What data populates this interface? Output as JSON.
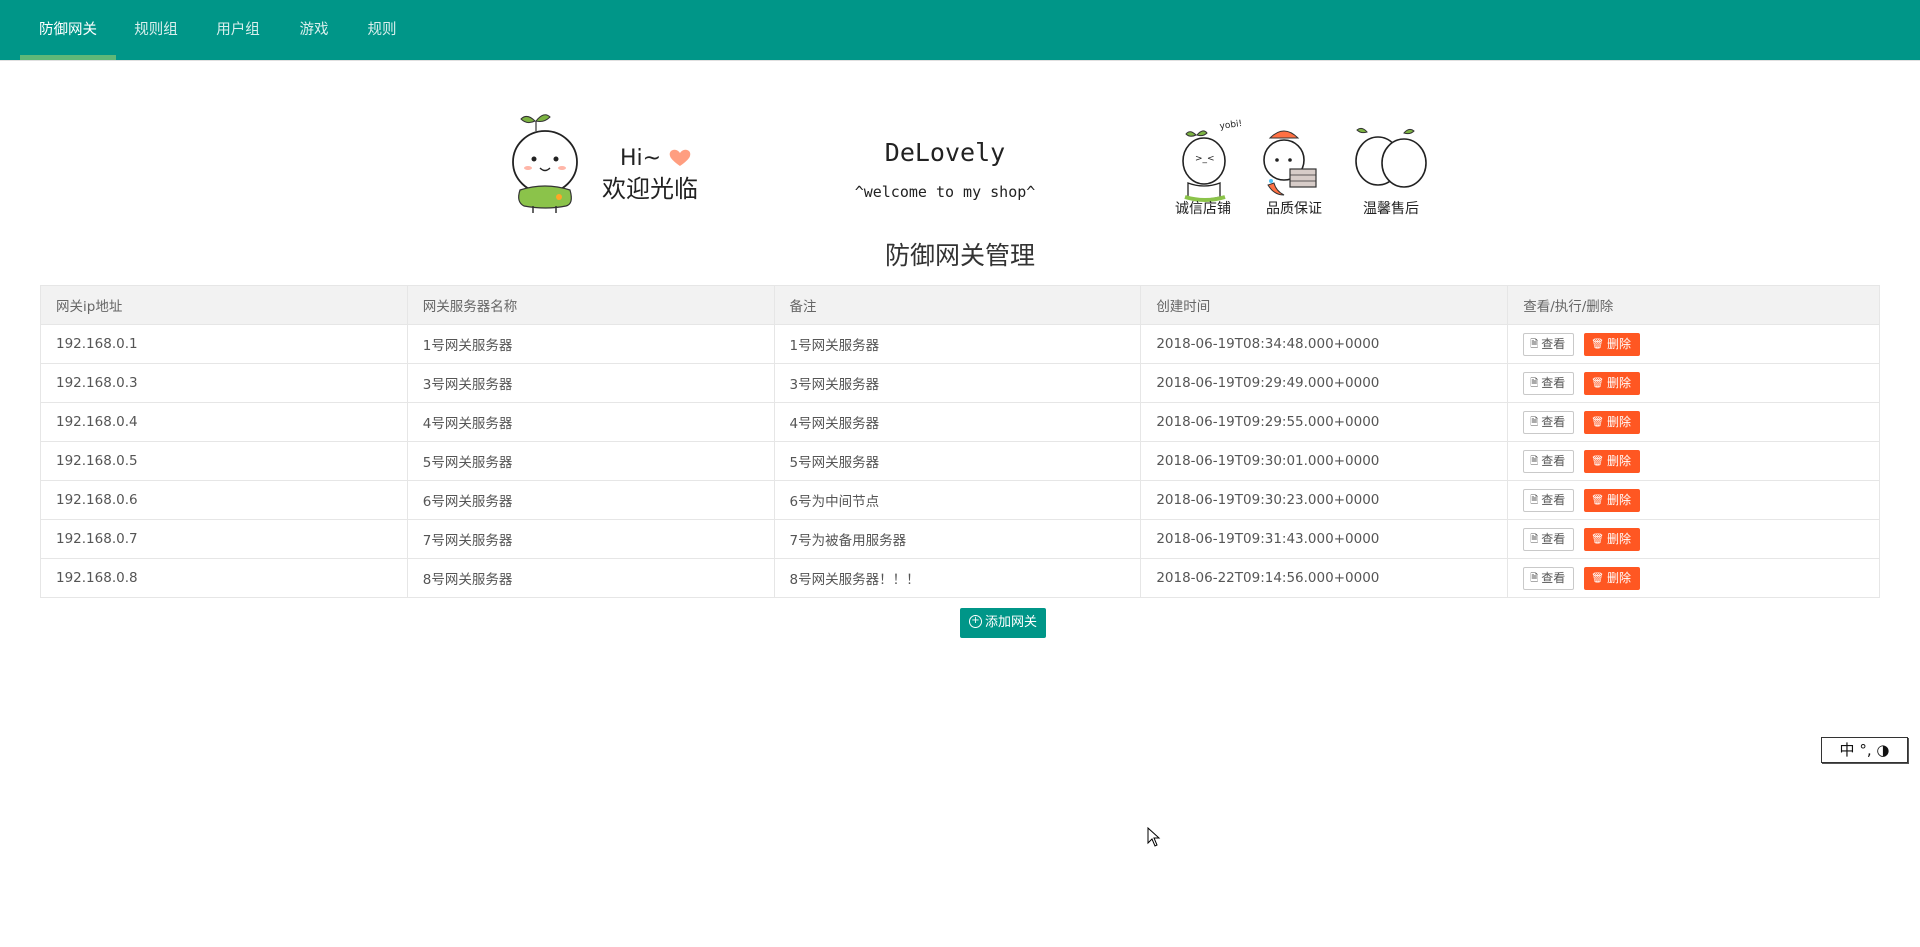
{
  "nav": {
    "items": [
      "防御网关",
      "规则组",
      "用户组",
      "游戏",
      "规则"
    ],
    "active_index": 0
  },
  "banner": {
    "greeting": "Hi~",
    "welcome": "欢迎光临",
    "brand": "DeLovely",
    "tagline": "^welcome to my shop^",
    "yobi": "yobi!",
    "features": [
      "诚信店铺",
      "品质保证",
      "温馨售后"
    ]
  },
  "page_title": "防御网关管理",
  "table": {
    "headers": [
      "网关ip地址",
      "网关服务器名称",
      "备注",
      "创建时间",
      "查看/执行/删除"
    ],
    "rows": [
      {
        "ip": "192.168.0.1",
        "name": "1号网关服务器",
        "remark": "1号网关服务器",
        "created": "2018-06-19T08:34:48.000+0000"
      },
      {
        "ip": "192.168.0.3",
        "name": "3号网关服务器",
        "remark": "3号网关服务器",
        "created": "2018-06-19T09:29:49.000+0000"
      },
      {
        "ip": "192.168.0.4",
        "name": "4号网关服务器",
        "remark": "4号网关服务器",
        "created": "2018-06-19T09:29:55.000+0000"
      },
      {
        "ip": "192.168.0.5",
        "name": "5号网关服务器",
        "remark": "5号网关服务器",
        "created": "2018-06-19T09:30:01.000+0000"
      },
      {
        "ip": "192.168.0.6",
        "name": "6号网关服务器",
        "remark": "6号为中间节点",
        "created": "2018-06-19T09:30:23.000+0000"
      },
      {
        "ip": "192.168.0.7",
        "name": "7号网关服务器",
        "remark": "7号为被备用服务器",
        "created": "2018-06-19T09:31:43.000+0000"
      },
      {
        "ip": "192.168.0.8",
        "name": "8号网关服务器",
        "remark": "8号网关服务器！！！",
        "created": "2018-06-22T09:14:56.000+0000"
      }
    ],
    "view_label": "查看",
    "delete_label": "删除"
  },
  "add_button": "添加网关",
  "ime": {
    "label": "中 °, ◑"
  },
  "colors": {
    "primary": "#009688",
    "danger": "#ff5722",
    "nav_active_underline": "#5fb878",
    "header_bg": "#f2f2f2"
  }
}
